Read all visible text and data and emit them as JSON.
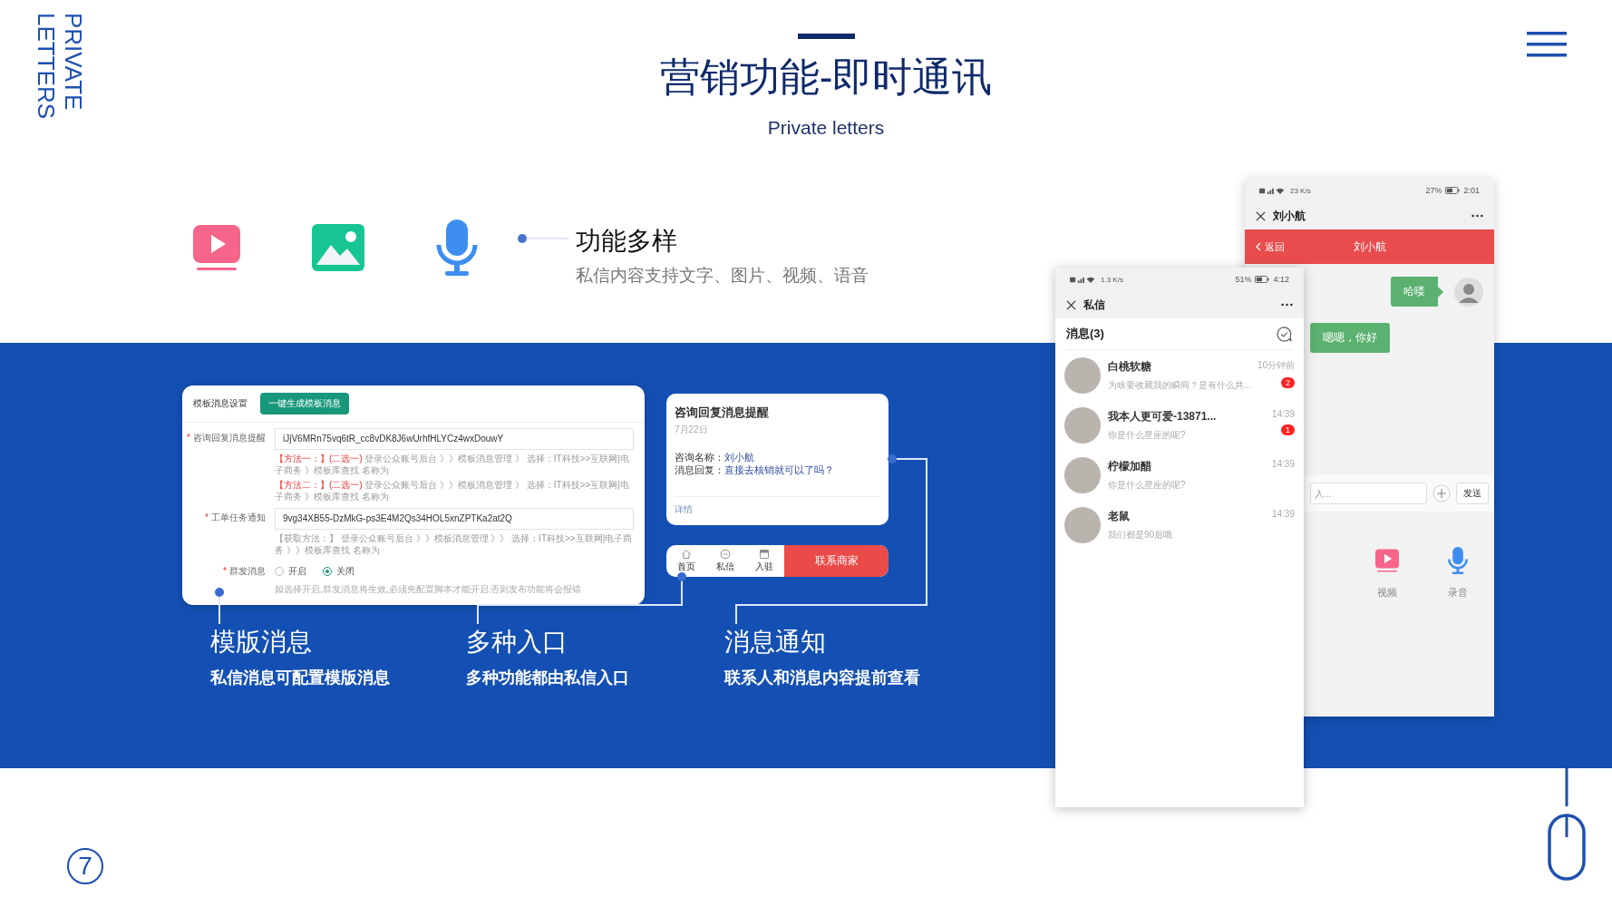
{
  "side_label": "PRIVATE LETTERS",
  "header": {
    "title": "营销功能-即时通讯",
    "subtitle": "Private letters"
  },
  "feature": {
    "title": "功能多样",
    "description": "私信内容支持文字、图片、视频、语音"
  },
  "template_card": {
    "heading": "模板消息设置",
    "generate_button": "一键生成模板消息",
    "fields": [
      {
        "marker": "*",
        "label": "咨询回复消息提醒",
        "value": "iJjV6MRn75vq6tR_cc8vDK8J6wUrhfHLYCz4wxDouwY",
        "notes": [
          {
            "highlight": "【方法一：】(二选一)",
            "text": "登录公众账号后台 》》模板消息管理 》 选择：IT科技>>互联网|电子商务 》模板库查找 名称为"
          },
          {
            "highlight": "【方法二：】(二选一)",
            "text": "登录公众账号后台 》》模板消息管理 》 选择：IT科技>>互联网|电子商务 》模板库查找 名称为"
          }
        ]
      },
      {
        "marker": "*",
        "label": "工单任务通知",
        "value": "9vg34XB55-DzMkG-ps3E4M2Qs34HOL5xnZPTKa2at2Q",
        "notes": [
          {
            "text": "【获取方法：】 登录公众账号后台 》》模板消息管理 》》 选择：IT科技>>互联网|电子商务 》》模板库查找 名称为"
          }
        ]
      }
    ],
    "broadcast": {
      "marker": "*",
      "label": "群发消息",
      "options": [
        {
          "label": "开启",
          "selected": false
        },
        {
          "label": "关闭",
          "selected": true
        }
      ],
      "hint": "如选择开启,群发消息将生效,必须先配置脚本才能开启,否则发布功能将会报错"
    }
  },
  "notice_card": {
    "title": "咨询回复消息提醒",
    "date": "7月22日",
    "lines": [
      {
        "label": "咨询名称：",
        "value": "刘小航"
      },
      {
        "label": "消息回复：",
        "value": "直接去核销就可以了吗？"
      }
    ],
    "link": "详情"
  },
  "bottom_bar": {
    "tabs": [
      {
        "label": "首页",
        "kind": "home"
      },
      {
        "label": "私信",
        "kind": "chat"
      },
      {
        "label": "入驻",
        "kind": "store"
      }
    ],
    "action": "联系商家"
  },
  "captions": [
    {
      "title": "模版消息",
      "description": "私信消息可配置模版消息"
    },
    {
      "title": "多种入口",
      "description": "多种功能都由私信入口"
    },
    {
      "title": "消息通知",
      "description": "联系人和消息内容提前查看"
    }
  ],
  "chat_list_phone": {
    "status": {
      "speed": "1.3 K/s",
      "battery": "51%",
      "time": "4:12"
    },
    "title": "私信",
    "section": "消息(3)",
    "conversations": [
      {
        "name": "白桃软糖",
        "preview": "为啥要收藏我的瞬间？是有什么共...",
        "time": "10分钟前",
        "unread": "2"
      },
      {
        "name": "我本人更可爱-13871...",
        "preview": "你是什么星座的呢?",
        "time": "14:39",
        "unread": "1"
      },
      {
        "name": "柠檬加醋",
        "preview": "你是什么星座的呢?",
        "time": "14:39"
      },
      {
        "name": "老鼠",
        "preview": "我们都是90后哦",
        "time": "14:39"
      }
    ]
  },
  "chat_phone": {
    "status": {
      "speed": "23 K/s",
      "battery": "27%",
      "time": "2:01"
    },
    "title": "刘小航",
    "nav": {
      "back": "返回",
      "title": "刘小航"
    },
    "messages": [
      {
        "text": "哈喽",
        "mine": true
      },
      {
        "text": "嗯嗯，你好",
        "mine": false
      }
    ],
    "input_placeholder": "入...",
    "send": "发送",
    "tools": [
      {
        "label": "视频",
        "kind": "video"
      },
      {
        "label": "录音",
        "kind": "mic"
      }
    ]
  },
  "page_number": "7"
}
